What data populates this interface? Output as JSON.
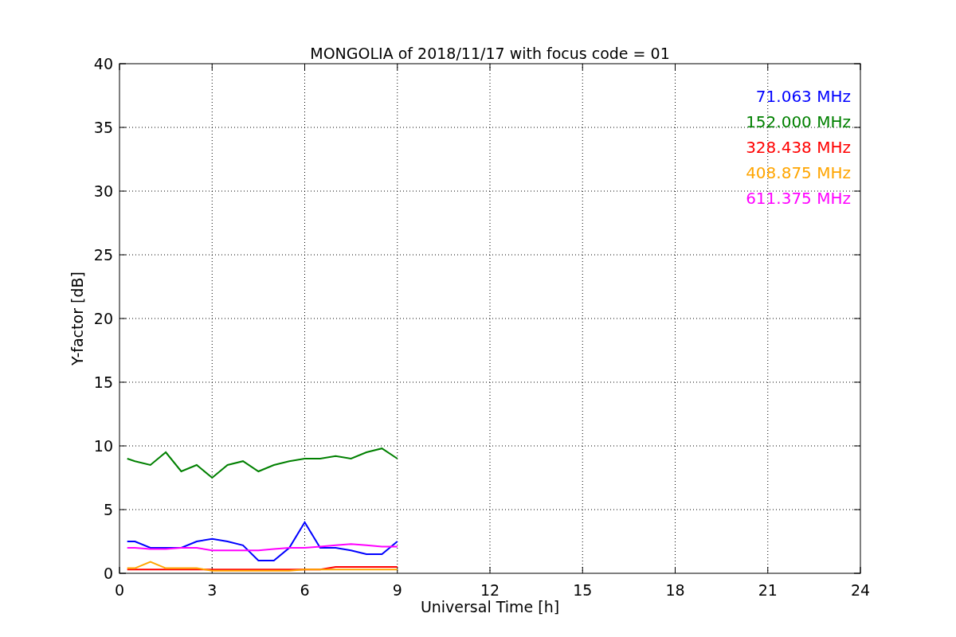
{
  "chart_data": {
    "type": "line",
    "title": "MONGOLIA of 2018/11/17 with focus code = 01",
    "xlabel": "Universal Time [h]",
    "ylabel": "Y-factor [dB]",
    "x": [
      0.25,
      0.5,
      1,
      1.5,
      2,
      2.5,
      3,
      3.5,
      4,
      4.5,
      5,
      5.5,
      6,
      6.5,
      7,
      7.5,
      8,
      8.5,
      9
    ],
    "series": [
      {
        "name": "71.063 MHz",
        "color": "#0000ff",
        "values": [
          2.5,
          2.5,
          2,
          2,
          2,
          2.5,
          2.7,
          2.5,
          2.2,
          1,
          1,
          2,
          4,
          2,
          2,
          1.8,
          1.5,
          1.5,
          2.5
        ]
      },
      {
        "name": "152.000 MHz",
        "color": "#008000",
        "values": [
          9,
          8.8,
          8.5,
          9.5,
          8,
          8.5,
          7.5,
          8.5,
          8.8,
          8,
          8.5,
          8.8,
          9,
          9,
          9.2,
          9,
          9.5,
          9.8,
          9
        ]
      },
      {
        "name": "328.438 MHz",
        "color": "#ff0000",
        "values": [
          0.3,
          0.3,
          0.3,
          0.3,
          0.3,
          0.3,
          0.3,
          0.3,
          0.3,
          0.3,
          0.3,
          0.3,
          0.3,
          0.3,
          0.5,
          0.5,
          0.5,
          0.5,
          0.5
        ]
      },
      {
        "name": "408.875 MHz",
        "color": "#ffa500",
        "values": [
          0.4,
          0.4,
          0.9,
          0.4,
          0.4,
          0.4,
          0.2,
          0.2,
          0.2,
          0.2,
          0.2,
          0.2,
          0.3,
          0.3,
          0.3,
          0.3,
          0.3,
          0.3,
          0.3
        ]
      },
      {
        "name": "611.375 MHz",
        "color": "#ff00ff",
        "values": [
          2,
          2,
          1.9,
          1.9,
          2,
          2,
          1.8,
          1.8,
          1.8,
          1.8,
          1.9,
          2,
          2,
          2.1,
          2.2,
          2.3,
          2.2,
          2.1,
          2.1
        ]
      }
    ],
    "xlim": [
      0,
      24
    ],
    "ylim": [
      0,
      40
    ],
    "xticks": [
      0,
      3,
      6,
      9,
      12,
      15,
      18,
      21,
      24
    ],
    "yticks": [
      0,
      5,
      10,
      15,
      20,
      25,
      30,
      35,
      40
    ],
    "grid": true
  }
}
